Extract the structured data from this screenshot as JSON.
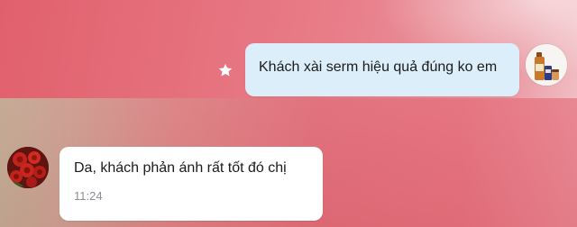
{
  "conversation": {
    "messages": [
      {
        "direction": "outgoing",
        "text": "Khách xài serm hiệu quả đúng ko em",
        "starred": true,
        "avatar": "product-bottles-avatar"
      },
      {
        "direction": "incoming",
        "text": "Da, khách phản ánh rất tốt đó chị",
        "time": "11:24",
        "avatar": "red-roses-avatar"
      }
    ]
  },
  "colors": {
    "outgoing_bubble": "#dbeef9",
    "incoming_bubble": "#ffffff",
    "wallpaper_pink": "#e1606d",
    "timestamp": "#8a8d91"
  }
}
